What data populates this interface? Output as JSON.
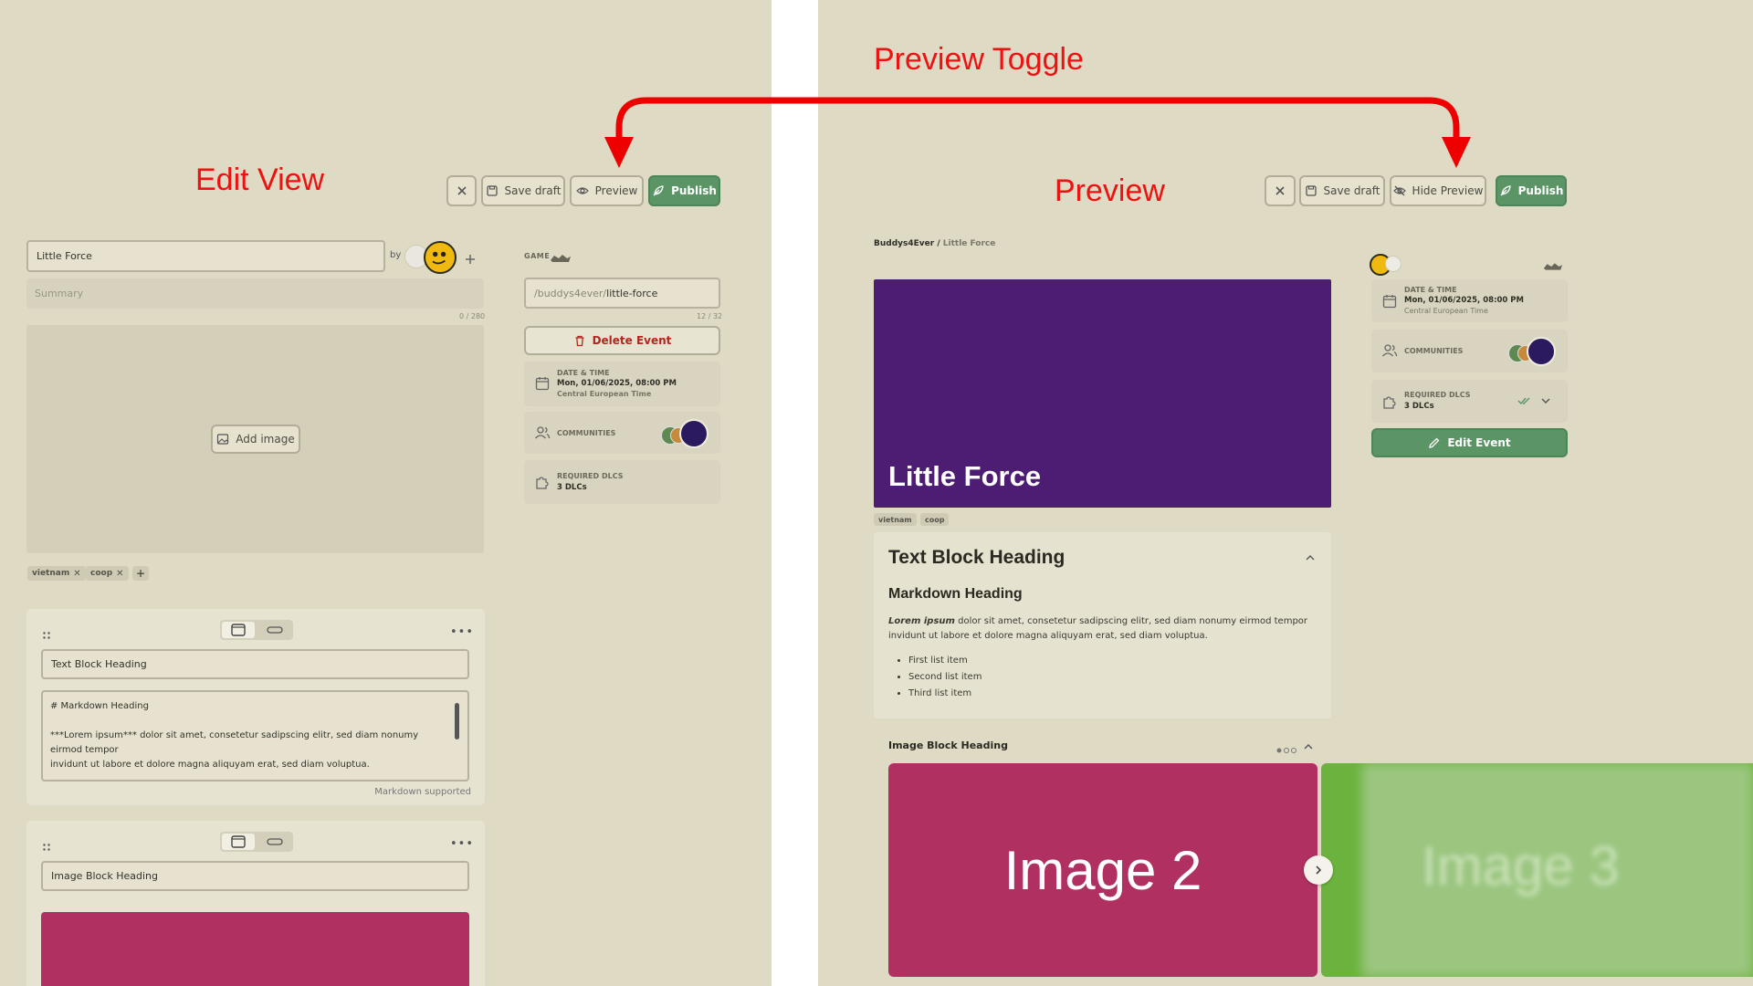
{
  "annotations": {
    "edit_view": "Edit View",
    "preview": "Preview",
    "preview_toggle": "Preview Toggle"
  },
  "toolbar": {
    "save_draft": "Save draft",
    "preview": "Preview",
    "hide_preview": "Hide Preview",
    "publish": "Publish"
  },
  "editor": {
    "title_value": "Little Force",
    "by_label": "by",
    "summary_placeholder": "Summary",
    "summary_counter": "0 / 280",
    "add_image": "Add image",
    "tags": [
      "vietnam",
      "coop"
    ],
    "text_block": {
      "heading_value": "Text Block Heading",
      "body_line1": "# Markdown Heading",
      "body_line2": "***Lorem ipsum*** dolor sit amet, consetetur sadipscing elitr, sed diam nonumy eirmod tempor",
      "body_line3": "invidunt ut labore et dolore magna aliquyam erat, sed diam voluptua.",
      "hint": "Markdown supported"
    },
    "image_block": {
      "heading_value": "Image Block Heading"
    }
  },
  "sidebar": {
    "game_label": "GAME",
    "slug_prefix": "/buddys4ever/",
    "slug_value": "little-force",
    "slug_counter": "12 / 32",
    "delete_event": "Delete Event",
    "datetime_label": "DATE & TIME",
    "datetime_value": "Mon, 01/06/2025, 08:00 PM",
    "timezone": "Central European Time",
    "communities_label": "COMMUNITIES",
    "dlcs_label": "REQUIRED DLCS",
    "dlcs_value": "3 DLCs",
    "edit_event": "Edit Event"
  },
  "preview": {
    "breadcrumb_root": "Buddys4Ever",
    "breadcrumb_sep": "/",
    "breadcrumb_current": "Little Force",
    "hero_title": "Little Force",
    "tags": [
      "vietnam",
      "coop"
    ],
    "text_block_heading": "Text Block Heading",
    "markdown_heading": "Markdown Heading",
    "para_bold": "Lorem ipsum",
    "para_rest": " dolor sit amet, consetetur sadipscing elitr, sed diam nonumy eirmod tempor invidunt ut labore et dolore magna aliquyam erat, sed diam voluptua.",
    "list_items": [
      "First list item",
      "Second list item",
      "Third list item"
    ],
    "image_block_heading": "Image Block Heading",
    "image2_label": "Image 2",
    "image3_label": "Image 3"
  },
  "colors": {
    "background": "#dedac4",
    "hero": "#4c1d72",
    "image_magenta": "#b03161",
    "image_green": "#6bb33e",
    "accent_green": "#5b9566",
    "annotation_red": "#ee1111",
    "delete_red": "#b3261e"
  }
}
